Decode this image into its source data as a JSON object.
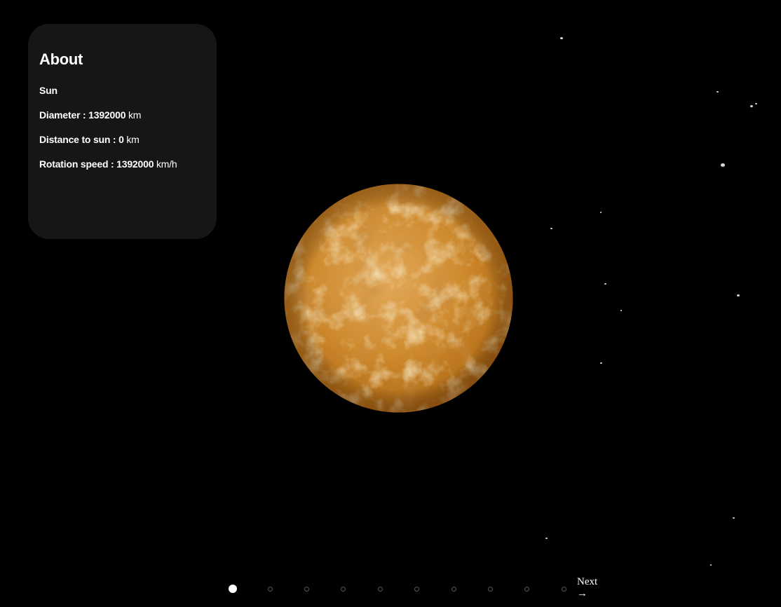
{
  "about": {
    "title": "About",
    "name": "Sun",
    "diameter_label": "Diameter : ",
    "diameter_value": "1392000",
    "diameter_unit": " km",
    "distance_label": "Distance to sun : ",
    "distance_value": "0",
    "distance_unit": " km",
    "rotation_label": "Rotation speed : ",
    "rotation_value": "1392000",
    "rotation_unit": " km/h"
  },
  "planet": {
    "name": "Sun",
    "base_color": "#c9801f",
    "highlight_color": "#e8c98a",
    "shadow_color": "#8a4a10"
  },
  "pagination": {
    "total": 10,
    "active_index": 0,
    "next_label": "Next",
    "next_arrow": "→"
  },
  "colors": {
    "background": "#000000",
    "panel": "#161616",
    "text": "#ffffff"
  }
}
